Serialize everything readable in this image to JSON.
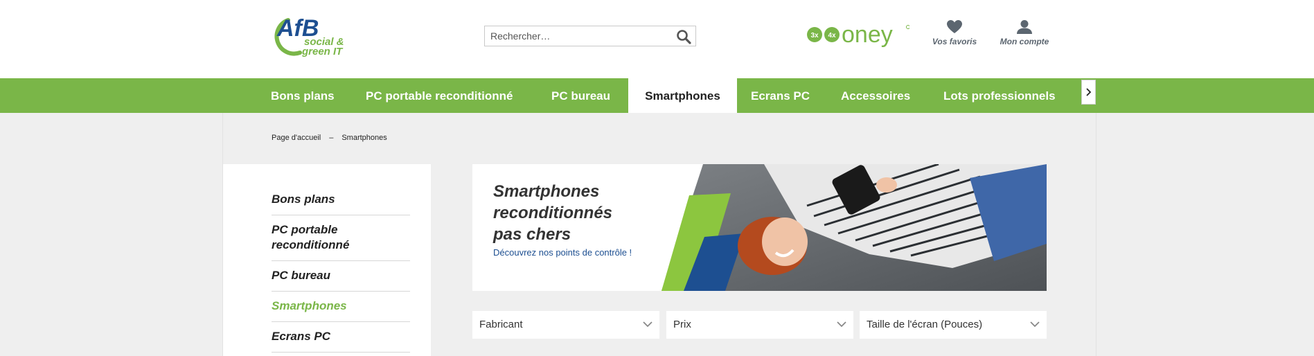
{
  "header": {
    "logo": {
      "brand": "AfB",
      "tagline_1": "social &",
      "tagline_2": "green IT"
    },
    "search": {
      "placeholder": "Rechercher…"
    },
    "oney": {
      "badge_3x": "3x",
      "badge_4x": "4x",
      "label": "oney"
    },
    "favorites_label": "Vos favoris",
    "account_label": "Mon compte"
  },
  "nav": {
    "items": [
      {
        "label": "Bons plans"
      },
      {
        "label": "PC portable reconditionné"
      },
      {
        "label": "PC bureau"
      },
      {
        "label": "Smartphones",
        "active": true
      },
      {
        "label": "Ecrans PC"
      },
      {
        "label": "Accessoires"
      },
      {
        "label": "Lots professionnels"
      }
    ]
  },
  "breadcrumb": {
    "home": "Page d'accueil",
    "separator": "–",
    "current": "Smartphones"
  },
  "sidebar": {
    "items": [
      {
        "label": "Bons plans"
      },
      {
        "label": "PC portable reconditionné"
      },
      {
        "label": "PC bureau"
      },
      {
        "label": "Smartphones",
        "active": true
      },
      {
        "label": "Ecrans PC"
      }
    ]
  },
  "banner": {
    "title_line_1": "Smartphones",
    "title_line_2": "reconditionnés",
    "title_line_3": "pas chers",
    "subtitle": "Découvrez nos points de contrôle !"
  },
  "filters": [
    {
      "label": "Fabricant"
    },
    {
      "label": "Prix"
    },
    {
      "label": "Taille de l'écran (Pouces)"
    }
  ],
  "colors": {
    "brand_green": "#7ab648",
    "brand_blue": "#1d4f91",
    "text_dark": "#222222",
    "icon_gray": "#5c6670",
    "page_bg": "#efefef"
  }
}
